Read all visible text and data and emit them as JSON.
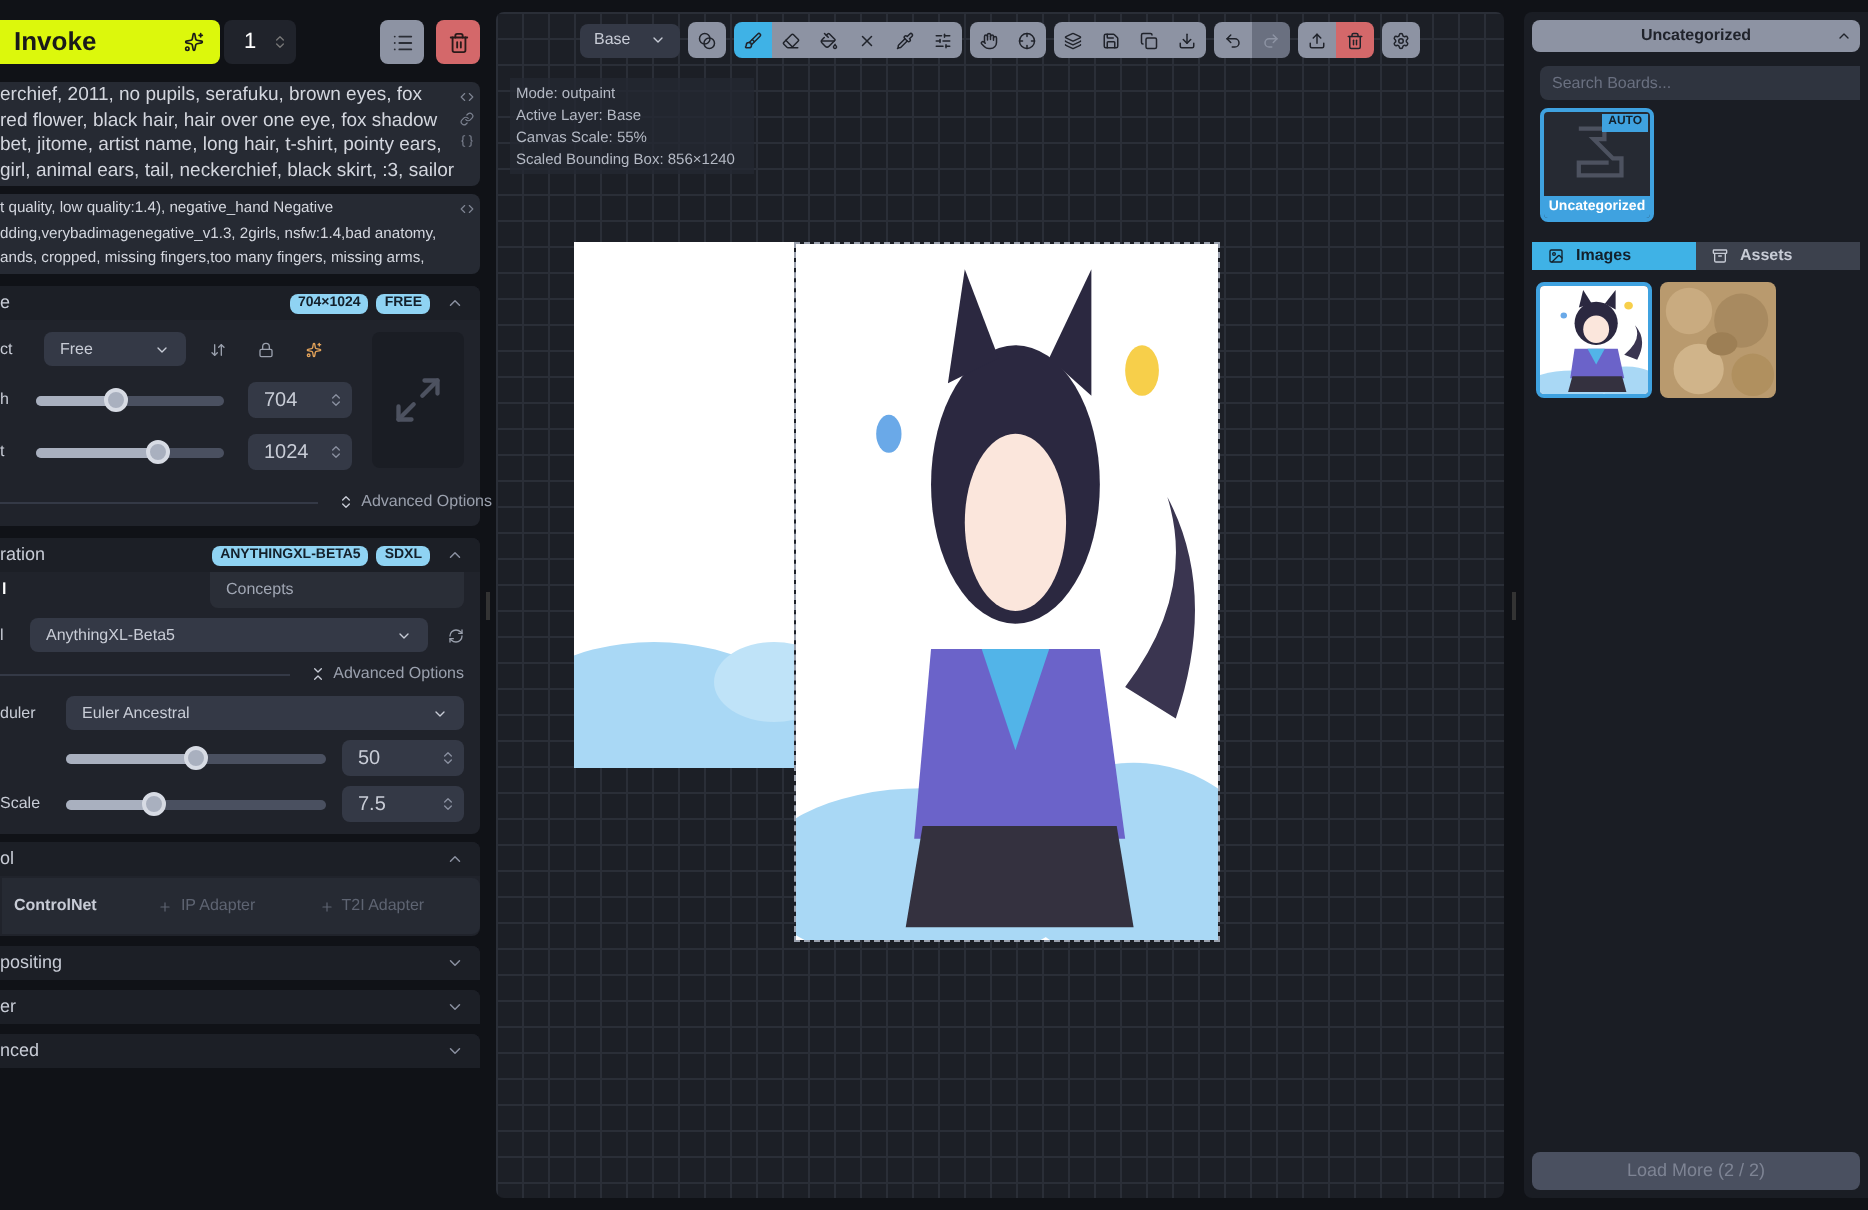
{
  "header": {
    "invoke_label": "Invoke",
    "iterations": "1"
  },
  "prompts": [
    {
      "lines": [
        "erchief, 2011, no pupils, serafuku, brown eyes, fox",
        "red flower, black hair, hair over one eye, fox shadow",
        "bet, jitome, artist name, long hair, t-shirt, pointy ears,",
        "girl, animal ears, tail, neckerchief, black skirt, :3, sailor"
      ]
    },
    {
      "lines": [
        "t quality, low quality:1.4), negative_hand Negative",
        "dding,verybadimagenegative_v1.3, 2girls, nsfw:1.4,bad anatomy,",
        "ands, cropped, missing fingers,too many fingers, missing arms,"
      ]
    }
  ],
  "image_section": {
    "title": "e",
    "badges": [
      "704×1024",
      "FREE"
    ],
    "expanded": true,
    "aspect": {
      "label": "ct",
      "value": "Free"
    },
    "sliders": [
      {
        "label": "h",
        "level": 0.43,
        "value": "704"
      },
      {
        "label": "t",
        "level": 0.65,
        "value": "1024"
      }
    ],
    "advanced": "Advanced Options"
  },
  "generation_section": {
    "title": "ration",
    "badges": [
      "ANYTHINGXL-BETA5",
      "SDXL"
    ],
    "expanded": true,
    "tabs": [
      {
        "label": "l",
        "selected": true
      },
      {
        "label": "Concepts",
        "selected": false
      }
    ],
    "model": {
      "label": "l",
      "value": "AnythingXL-Beta5"
    },
    "advanced": "Advanced Options",
    "scheduler": {
      "label": "duler",
      "value": "Euler Ancestral"
    },
    "sliders": [
      {
        "level": 0.5,
        "value": "50"
      },
      {
        "label": "Scale",
        "level": 0.34,
        "value": "7.5"
      }
    ]
  },
  "control_section": {
    "title": "ol",
    "expanded": true,
    "adapters": [
      {
        "label": "ControlNet",
        "disabled": false
      },
      {
        "label": "IP Adapter",
        "disabled": true
      },
      {
        "label": "T2I Adapter",
        "disabled": true
      }
    ]
  },
  "collapsed_sections": [
    {
      "title": "positing",
      "expanded": false
    },
    {
      "title": "er",
      "expanded": false
    },
    {
      "title": "nced",
      "expanded": false
    }
  ],
  "canvas": {
    "layer_select": "Base",
    "tool_groups": [
      [
        {
          "kind": "palette",
          "selected": false,
          "disabled": false
        }
      ],
      [
        {
          "kind": "brush",
          "selected": true,
          "disabled": false
        },
        {
          "kind": "eraser",
          "selected": false,
          "disabled": false
        },
        {
          "kind": "fill",
          "selected": false,
          "disabled": false
        },
        {
          "kind": "clear",
          "selected": false,
          "disabled": false
        },
        {
          "kind": "picker",
          "selected": false,
          "disabled": false
        },
        {
          "kind": "sliders",
          "selected": false,
          "disabled": false
        }
      ],
      [
        {
          "kind": "move",
          "selected": false,
          "disabled": false
        },
        {
          "kind": "reset",
          "selected": false,
          "disabled": false
        }
      ],
      [
        {
          "kind": "merge",
          "selected": false,
          "disabled": false
        },
        {
          "kind": "save",
          "selected": false,
          "disabled": false
        },
        {
          "kind": "copy",
          "selected": false,
          "disabled": false
        },
        {
          "kind": "download",
          "selected": false,
          "disabled": false
        }
      ],
      [
        {
          "kind": "undo",
          "selected": false,
          "disabled": false
        },
        {
          "kind": "redo",
          "selected": false,
          "disabled": true
        }
      ],
      [
        {
          "kind": "upload",
          "selected": false,
          "disabled": false
        },
        {
          "kind": "delete",
          "selected": false,
          "disabled": false
        }
      ],
      [
        {
          "kind": "settings",
          "selected": false,
          "disabled": false
        }
      ]
    ],
    "info": [
      "Mode: outpaint",
      "Active Layer: Base",
      "Canvas Scale: 55%",
      "Scaled Bounding Box: 856×1240"
    ],
    "image": {
      "kind": "picture"
    }
  },
  "gallery": {
    "board_selector": "Uncategorized",
    "search_placeholder": "Search Boards...",
    "boards": [
      {
        "name": "Uncategorized",
        "badge": "AUTO",
        "selected": true
      }
    ],
    "tabs": [
      {
        "label": "Images",
        "kind": "images",
        "selected": true
      },
      {
        "label": "Assets",
        "kind": "assets",
        "selected": false
      }
    ],
    "images": [
      {
        "kind": "picture",
        "selected": true
      },
      {
        "kind": "texture",
        "selected": false
      }
    ],
    "load_more": "Load More (2 / 2)"
  }
}
